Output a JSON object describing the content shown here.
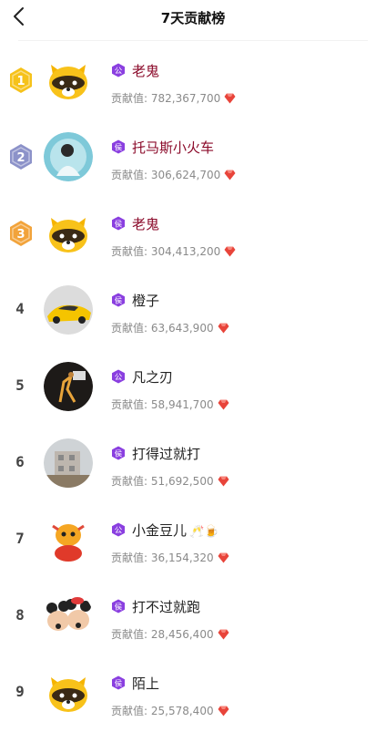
{
  "header": {
    "title": "7天贡献榜"
  },
  "contrib_label": "贡献值:",
  "badge_gong": "公",
  "badge_hou": "侯",
  "colors": {
    "top_name": "#8b0a2a",
    "badge_purple": "#8a3fe0",
    "gem_red": "#e8443a",
    "gold": "#f6c21a",
    "silver": "#8c92c9",
    "bronze": "#f2a33a"
  },
  "rows": [
    {
      "rank": "1",
      "name": "老鬼",
      "badge": "公",
      "value": "782,367,700",
      "avatar": "raccoon-avatar"
    },
    {
      "rank": "2",
      "name": "托马斯小火车",
      "badge": "侯",
      "value": "306,624,700",
      "avatar": "singer-avatar"
    },
    {
      "rank": "3",
      "name": "老鬼",
      "badge": "侯",
      "value": "304,413,200",
      "avatar": "raccoon-avatar"
    },
    {
      "rank": "4",
      "name": "橙子",
      "badge": "侯",
      "value": "63,643,900",
      "avatar": "yellow-car-avatar"
    },
    {
      "rank": "5",
      "name": "凡之刃",
      "badge": "公",
      "value": "58,941,700",
      "avatar": "basketball-avatar"
    },
    {
      "rank": "6",
      "name": "打得过就打",
      "badge": "侯",
      "value": "51,692,500",
      "avatar": "building-avatar"
    },
    {
      "rank": "7",
      "name": "小金豆儿",
      "badge": "公",
      "value": "36,154,320",
      "avatar": "cartoon-cow-avatar",
      "emoji": "🥂🍺"
    },
    {
      "rank": "8",
      "name": "打不过就跑",
      "badge": "侯",
      "value": "28,456,400",
      "avatar": "mickey-minnie-avatar"
    },
    {
      "rank": "9",
      "name": "陌上",
      "badge": "侯",
      "value": "25,578,400",
      "avatar": "raccoon-avatar"
    }
  ]
}
